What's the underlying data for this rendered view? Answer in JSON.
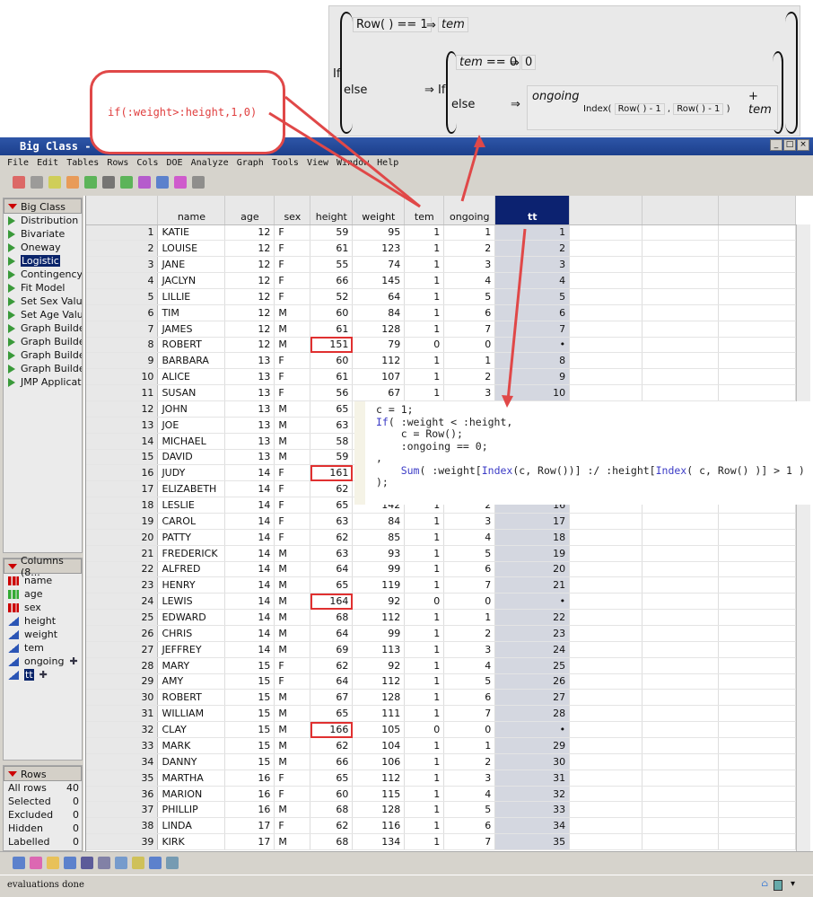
{
  "window": {
    "title": "Big Class - JMP",
    "controls": [
      "_",
      "□",
      "×"
    ]
  },
  "menu": [
    "File",
    "Edit",
    "Tables",
    "Rows",
    "Cols",
    "DOE",
    "Analyze",
    "Graph",
    "Tools",
    "View",
    "Window",
    "Help"
  ],
  "left_panel": {
    "table_name": "Big Class",
    "scripts": [
      "Distribution",
      "Bivariate",
      "Oneway",
      "Logistic",
      "Contingency",
      "Fit Model",
      "Set Sex Value",
      "Set Age Value",
      "Graph Builder",
      "Graph Builder",
      "Graph Builder",
      "Graph Builder",
      "JMP Application"
    ],
    "selected_script": "Logistic",
    "columns_header": "Columns (8...",
    "columns": [
      {
        "name": "name",
        "type": "nominal"
      },
      {
        "name": "age",
        "type": "ordinal"
      },
      {
        "name": "sex",
        "type": "nominal"
      },
      {
        "name": "height",
        "type": "continuous"
      },
      {
        "name": "weight",
        "type": "continuous"
      },
      {
        "name": "tem",
        "type": "continuous"
      },
      {
        "name": "ongoing",
        "type": "continuous",
        "formula": true
      },
      {
        "name": "tt",
        "type": "continuous",
        "formula": true,
        "selected": true
      }
    ],
    "rows_header": "Rows",
    "rows_stats": [
      {
        "label": "All rows",
        "value": "40"
      },
      {
        "label": "Selected",
        "value": "0"
      },
      {
        "label": "Excluded",
        "value": "0"
      },
      {
        "label": "Hidden",
        "value": "0"
      },
      {
        "label": "Labelled",
        "value": "0"
      }
    ]
  },
  "table": {
    "headers": [
      "name",
      "age",
      "sex",
      "height",
      "weight",
      "tem",
      "ongoing",
      "tt"
    ],
    "rows": [
      [
        "1",
        "KATIE",
        "12",
        "F",
        "59",
        "95",
        "1",
        "1",
        "1"
      ],
      [
        "2",
        "LOUISE",
        "12",
        "F",
        "61",
        "123",
        "1",
        "2",
        "2"
      ],
      [
        "3",
        "JANE",
        "12",
        "F",
        "55",
        "74",
        "1",
        "3",
        "3"
      ],
      [
        "4",
        "JACLYN",
        "12",
        "F",
        "66",
        "145",
        "1",
        "4",
        "4"
      ],
      [
        "5",
        "LILLIE",
        "12",
        "F",
        "52",
        "64",
        "1",
        "5",
        "5"
      ],
      [
        "6",
        "TIM",
        "12",
        "M",
        "60",
        "84",
        "1",
        "6",
        "6"
      ],
      [
        "7",
        "JAMES",
        "12",
        "M",
        "61",
        "128",
        "1",
        "7",
        "7"
      ],
      [
        "8",
        "ROBERT",
        "12",
        "M",
        "151",
        "79",
        "0",
        "0",
        "•"
      ],
      [
        "9",
        "BARBARA",
        "13",
        "F",
        "60",
        "112",
        "1",
        "1",
        "8"
      ],
      [
        "10",
        "ALICE",
        "13",
        "F",
        "61",
        "107",
        "1",
        "2",
        "9"
      ],
      [
        "11",
        "SUSAN",
        "13",
        "F",
        "56",
        "67",
        "1",
        "3",
        "10"
      ],
      [
        "12",
        "JOHN",
        "13",
        "M",
        "65",
        "",
        "",
        "",
        ""
      ],
      [
        "13",
        "JOE",
        "13",
        "M",
        "63",
        "",
        "",
        "",
        ""
      ],
      [
        "14",
        "MICHAEL",
        "13",
        "M",
        "58",
        "",
        "",
        "",
        ""
      ],
      [
        "15",
        "DAVID",
        "13",
        "M",
        "59",
        "",
        "",
        "",
        ""
      ],
      [
        "16",
        "JUDY",
        "14",
        "F",
        "161",
        "",
        "",
        "",
        ""
      ],
      [
        "17",
        "ELIZABETH",
        "14",
        "F",
        "62",
        "",
        "",
        "",
        ""
      ],
      [
        "18",
        "LESLIE",
        "14",
        "F",
        "65",
        "142",
        "1",
        "2",
        "16"
      ],
      [
        "19",
        "CAROL",
        "14",
        "F",
        "63",
        "84",
        "1",
        "3",
        "17"
      ],
      [
        "20",
        "PATTY",
        "14",
        "F",
        "62",
        "85",
        "1",
        "4",
        "18"
      ],
      [
        "21",
        "FREDERICK",
        "14",
        "M",
        "63",
        "93",
        "1",
        "5",
        "19"
      ],
      [
        "22",
        "ALFRED",
        "14",
        "M",
        "64",
        "99",
        "1",
        "6",
        "20"
      ],
      [
        "23",
        "HENRY",
        "14",
        "M",
        "65",
        "119",
        "1",
        "7",
        "21"
      ],
      [
        "24",
        "LEWIS",
        "14",
        "M",
        "164",
        "92",
        "0",
        "0",
        "•"
      ],
      [
        "25",
        "EDWARD",
        "14",
        "M",
        "68",
        "112",
        "1",
        "1",
        "22"
      ],
      [
        "26",
        "CHRIS",
        "14",
        "M",
        "64",
        "99",
        "1",
        "2",
        "23"
      ],
      [
        "27",
        "JEFFREY",
        "14",
        "M",
        "69",
        "113",
        "1",
        "3",
        "24"
      ],
      [
        "28",
        "MARY",
        "15",
        "F",
        "62",
        "92",
        "1",
        "4",
        "25"
      ],
      [
        "29",
        "AMY",
        "15",
        "F",
        "64",
        "112",
        "1",
        "5",
        "26"
      ],
      [
        "30",
        "ROBERT",
        "15",
        "M",
        "67",
        "128",
        "1",
        "6",
        "27"
      ],
      [
        "31",
        "WILLIAM",
        "15",
        "M",
        "65",
        "111",
        "1",
        "7",
        "28"
      ],
      [
        "32",
        "CLAY",
        "15",
        "M",
        "166",
        "105",
        "0",
        "0",
        "•"
      ],
      [
        "33",
        "MARK",
        "15",
        "M",
        "62",
        "104",
        "1",
        "1",
        "29"
      ],
      [
        "34",
        "DANNY",
        "15",
        "M",
        "66",
        "106",
        "1",
        "2",
        "30"
      ],
      [
        "35",
        "MARTHA",
        "16",
        "F",
        "65",
        "112",
        "1",
        "3",
        "31"
      ],
      [
        "36",
        "MARION",
        "16",
        "F",
        "60",
        "115",
        "1",
        "4",
        "32"
      ],
      [
        "37",
        "PHILLIP",
        "16",
        "M",
        "68",
        "128",
        "1",
        "5",
        "33"
      ],
      [
        "38",
        "LINDA",
        "17",
        "F",
        "62",
        "116",
        "1",
        "6",
        "34"
      ],
      [
        "39",
        "KIRK",
        "17",
        "M",
        "68",
        "134",
        "1",
        "7",
        "35"
      ]
    ],
    "highlighted_heights": [
      "8",
      "16",
      "24",
      "32"
    ]
  },
  "annotations": {
    "callout": "if(:weight>:height,1,0)",
    "formula": {
      "if": "If",
      "row": "Row",
      "eq": "==",
      "one": "1",
      "arrow": "⇒",
      "tem": "tem",
      "else": "else",
      "zero": "0",
      "ongoing": "ongoing",
      "index": "Index",
      "minus": "-",
      "comma": ",",
      "plus": "+"
    },
    "code": [
      "c = 1;",
      "If( :weight < :height,",
      "    c = Row();",
      "    :ongoing == 0;",
      ",",
      "    Sum( :weight[Index(c, Row())] :/ :height[Index( c, Row() )] > 1 )",
      ");"
    ]
  },
  "status": {
    "text": "evaluations done"
  },
  "colors": {
    "accent": "#0c2270",
    "annotation_red": "#e04040",
    "tt_column": "#d4d7e0"
  }
}
